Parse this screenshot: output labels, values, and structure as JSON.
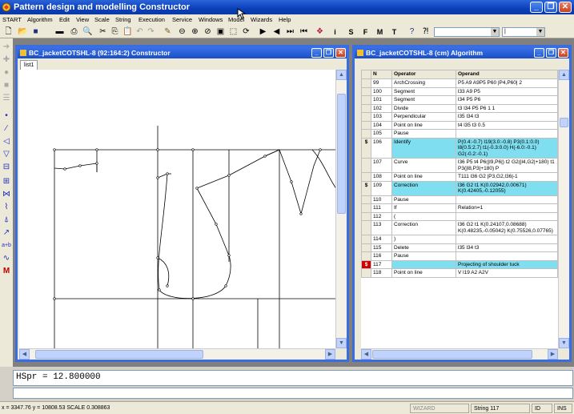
{
  "app": {
    "title": "Pattern design and modelling  Constructor"
  },
  "menu": [
    "START",
    "Algorithm",
    "Edit",
    "View",
    "Scale",
    "String",
    "Execution",
    "Service",
    "Windows",
    "Model",
    "Wizards",
    "Help"
  ],
  "toolbar": {
    "letters": [
      "i",
      "S",
      "F",
      "M",
      "T"
    ],
    "combo2_value": "|"
  },
  "constructor_window": {
    "title": "BC_jacketCOTSHL-8 (92:164:2) Constructor",
    "tab": "list1"
  },
  "algorithm_window": {
    "title": "BC_jacketCOTSHL-8 (cm) Algorithm",
    "headers": [
      "N",
      "Operator",
      "Operand"
    ],
    "rows": [
      {
        "mark": "",
        "n": "99",
        "op": "ArchCrossing",
        "operand": "P5 A9 A9P5 P60 |P4,P60| 2",
        "hl": false
      },
      {
        "mark": "",
        "n": "100",
        "op": "Segment",
        "operand": "l33 A9 P5",
        "hl": false
      },
      {
        "mark": "",
        "n": "101",
        "op": "Segment",
        "operand": "l34 P5 P6",
        "hl": false
      },
      {
        "mark": "",
        "n": "102",
        "op": "Divide",
        "operand": "t3 l34 P5 P6 1 1",
        "hl": false
      },
      {
        "mark": "",
        "n": "103",
        "op": "Perpendicular",
        "operand": "l35 l34 t3",
        "hl": false
      },
      {
        "mark": "",
        "n": "104",
        "op": "Point on line",
        "operand": "t4 l35 t3 0.5",
        "hl": false
      },
      {
        "mark": "",
        "n": "105",
        "op": "Pause",
        "operand": "",
        "hl": false
      },
      {
        "mark": "$",
        "n": "106",
        "op": "Identify",
        "operand": "P(0.4:-0.7) l19(3.0:-0.8) P3(0.1:0.0) l8(0.5:2.7) t1(-0.3:0.0) H(-6.0:-0.1) G2(-0.2:-0.1)",
        "hl": true
      },
      {
        "mark": "",
        "n": "107",
        "op": "Curve",
        "operand": "l36 P5 t4 P6(|l9,P6|) t2 G2(|l4,G2|+180) t1 P3(|l8,P3|+180) P",
        "hl": false
      },
      {
        "mark": "",
        "n": "108",
        "op": "Point on line",
        "operand": "T111 l36 G2 |P3,G2,l36|-1",
        "hl": false
      },
      {
        "mark": "$",
        "n": "109",
        "op": "Correction",
        "operand": "l36 G2 t1 K(0.02942,0.00671) K(0.42405,-0.12055)",
        "hl": true
      },
      {
        "mark": "",
        "n": "110",
        "op": "Pause",
        "operand": "",
        "hl": false
      },
      {
        "mark": "",
        "n": "111",
        "op": "If",
        "operand": "Relation=1",
        "hl": false
      },
      {
        "mark": "",
        "n": "112",
        "op": "(",
        "operand": "",
        "hl": false
      },
      {
        "mark": "",
        "n": "113",
        "op": "Correction",
        "operand": "l36 G2 t1 K(0.24107,0.08688) K(0.48235,-0.05042) K(0.75526,0.07765)",
        "hl": false
      },
      {
        "mark": "",
        "n": "114",
        "op": ")",
        "operand": "",
        "hl": false
      },
      {
        "mark": "",
        "n": "115",
        "op": "Delete",
        "operand": "l35 l34 t3",
        "hl": false
      },
      {
        "mark": "",
        "n": "116",
        "op": "Pause",
        "operand": "",
        "hl": false
      },
      {
        "mark": "$",
        "n": "117",
        "op": "",
        "operand": "Projecting of shoulder tuck",
        "hl": true,
        "red": true
      },
      {
        "mark": "",
        "n": "118",
        "op": "Point on line",
        "operand": "V l19 A2 A2V",
        "hl": false
      }
    ]
  },
  "command": {
    "text": "HSpr = 12.800000"
  },
  "status": {
    "coords": "x = 3347.76    y = 10808.53 SCALE 0.308863",
    "wizard": "WIZARD",
    "string": "String 117",
    "id": "ID",
    "ins": "INS"
  },
  "colors": {
    "title": "#0a3fb8",
    "highlight": "#7fdff0",
    "marker_red": "#d00000"
  }
}
